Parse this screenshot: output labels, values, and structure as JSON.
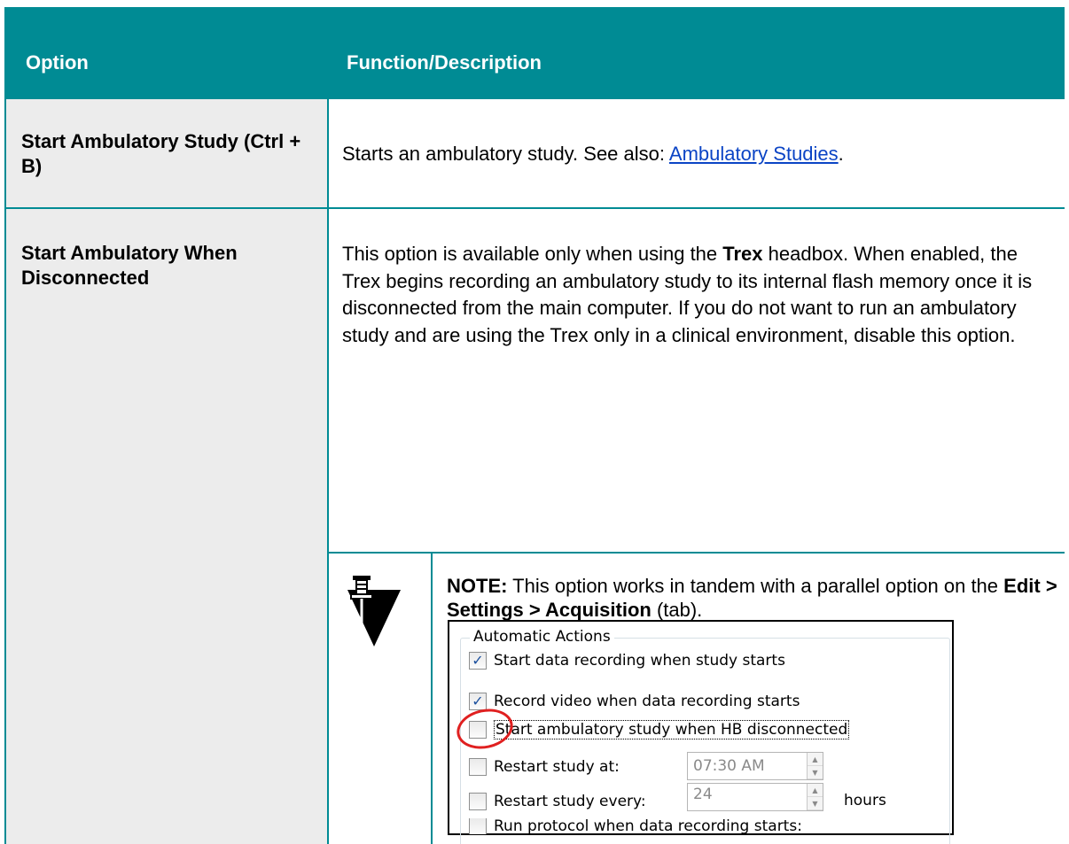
{
  "header": {
    "option_label": "Option",
    "function_label": "Function/Description"
  },
  "rows": [
    {
      "option": "Start Ambulatory Study (Ctrl + B)",
      "description_prefix": "Starts an ambulatory study. See also: ",
      "description_link": "Ambulatory Studies",
      "description_suffix": "."
    },
    {
      "option_line1": "Start Ambulatory When",
      "option_line2": "Disconnected",
      "desc_p1": "This option is available only when using the ",
      "desc_bold": "Trex",
      "desc_p2": " headbox. When enabled, the Trex begins recording an ambulatory study to its internal flash memory once it is disconnected from the main computer. If you do not want to run an ambulatory study and are using the Trex only in a clinical environment, disable this option."
    }
  ],
  "note": {
    "label": "NOTE:",
    "text1": " This option works in tandem with a parallel option on the ",
    "path": "Edit > Settings > Acquisition",
    "text2": " (tab).",
    "icon": "pushpin-note-icon"
  },
  "dialog": {
    "group_title": "Automatic Actions",
    "items": [
      {
        "label": "Start data recording when study starts",
        "checked": true
      },
      {
        "label": "Record video when data recording starts",
        "checked": true
      },
      {
        "label": "Start ambulatory study when HB disconnected",
        "checked": false
      },
      {
        "label": "Restart study at:",
        "checked": false
      },
      {
        "label": "Restart study every:",
        "checked": false
      },
      {
        "label": "Run protocol when data recording starts:",
        "checked": false
      }
    ],
    "time_value": "07:30 AM",
    "every_value": "24",
    "hours_label": "hours"
  }
}
